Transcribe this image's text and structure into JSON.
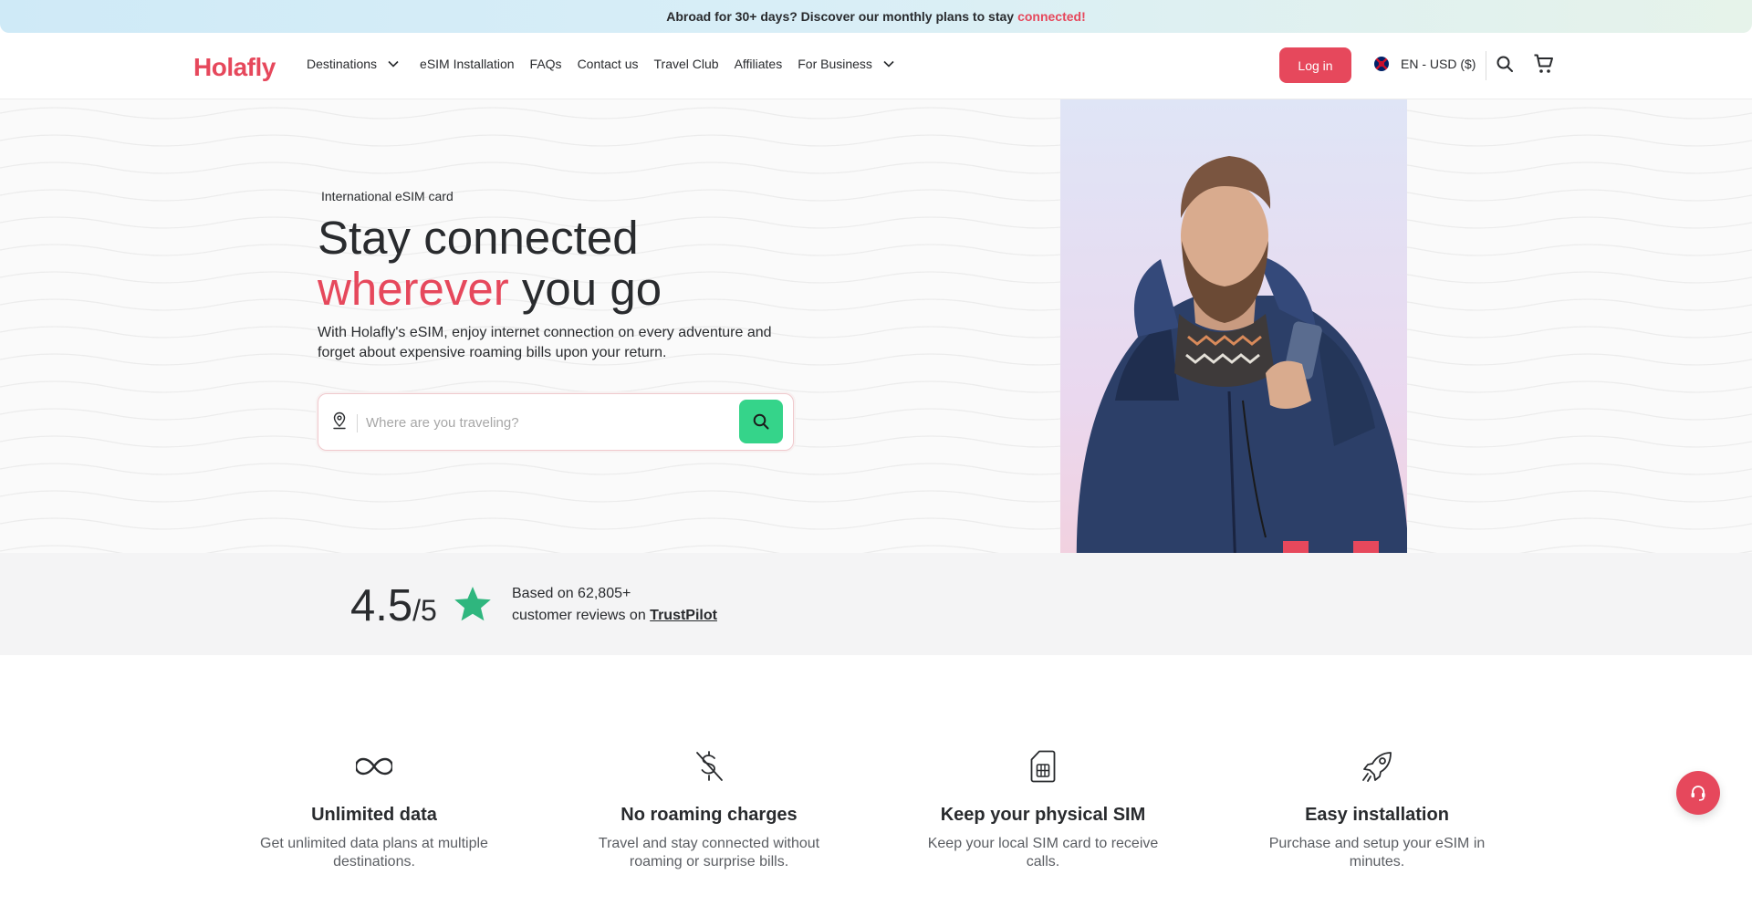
{
  "banner": {
    "text": "Abroad for 30+ days? Discover our monthly plans to stay",
    "highlight": "connected!"
  },
  "header": {
    "logo": "Holafly",
    "nav": [
      {
        "label": "Destinations",
        "dropdown": true
      },
      {
        "label": "eSIM Installation",
        "dropdown": false
      },
      {
        "label": "FAQs",
        "dropdown": false
      },
      {
        "label": "Contact us",
        "dropdown": false
      },
      {
        "label": "Travel Club",
        "dropdown": false
      },
      {
        "label": "Affiliates",
        "dropdown": false
      },
      {
        "label": "For Business",
        "dropdown": true
      }
    ],
    "login_label": "Log in",
    "language": "EN - USD ($)",
    "icons": [
      "uk-flag-icon",
      "search-icon",
      "cart-icon"
    ]
  },
  "hero": {
    "eyebrow": "International eSIM card",
    "headline_line1": "Stay connected",
    "headline_highlight": "wherever",
    "headline_rest": " you go",
    "description": "With Holafly's eSIM, enjoy internet connection on every adventure and forget about expensive roaming bills upon your return.",
    "search_placeholder": "Where are you traveling?",
    "search_value": ""
  },
  "rating": {
    "score": "4.5",
    "out_of": "/5",
    "line1": "Based on 62,805+",
    "line2_prefix": "customer reviews on",
    "link": "TrustPilot"
  },
  "features": [
    {
      "icon": "infinity-icon",
      "title": "Unlimited data",
      "text": "Get unlimited data plans at multiple destinations."
    },
    {
      "icon": "no-dollar-icon",
      "title": "No roaming charges",
      "text": "Travel and stay connected without roaming or surprise bills."
    },
    {
      "icon": "sim-card-icon",
      "title": "Keep your physical SIM",
      "text": "Keep your local SIM card to receive calls."
    },
    {
      "icon": "rocket-icon",
      "title": "Easy installation",
      "text": "Purchase and setup your eSIM in minutes."
    }
  ],
  "colors": {
    "brand": "#e6485c",
    "search_button": "#35d48a",
    "trustpilot_star": "#2fb67e"
  }
}
